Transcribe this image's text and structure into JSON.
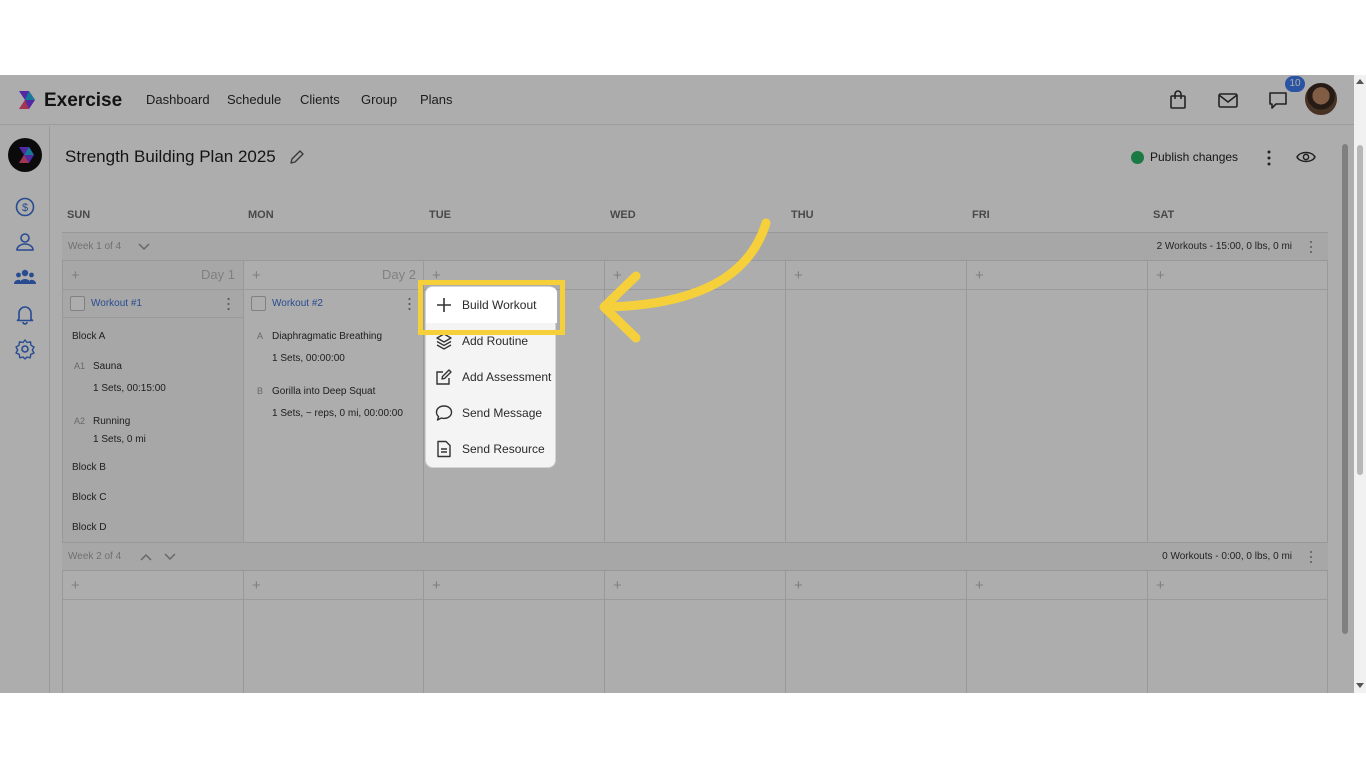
{
  "app": {
    "brand": "Exercise",
    "notification_count": "10"
  },
  "nav": [
    "Dashboard",
    "Schedule",
    "Clients",
    "Group",
    "Plans"
  ],
  "plan": {
    "title": "Strength Building Plan 2025",
    "publish_label": "Publish changes",
    "publish_color": "#28b463"
  },
  "days": [
    "SUN",
    "MON",
    "TUE",
    "WED",
    "THU",
    "FRI",
    "SAT"
  ],
  "weeks": [
    {
      "label": "Week 1 of 4",
      "summary": "2 Workouts - 15:00, 0 lbs, 0 mi"
    },
    {
      "label": "Week 2 of 4",
      "summary": "0 Workouts - 0:00, 0 lbs, 0 mi"
    }
  ],
  "day_labels": {
    "sun": "Day 1",
    "mon": "Day 2"
  },
  "workout1": {
    "title": "Workout #1",
    "block_a": "Block A",
    "a1_tag": "A1",
    "a1_name": "Sauna",
    "a1_detail": "1 Sets, 00:15:00",
    "a2_tag": "A2",
    "a2_name": "Running",
    "a2_detail": "1 Sets, 0 mi",
    "block_b": "Block B",
    "block_c": "Block C",
    "block_d": "Block D"
  },
  "workout2": {
    "title": "Workout #2",
    "a_tag": "A",
    "a_name": "Diaphragmatic Breathing",
    "a_detail": "1 Sets, 00:00:00",
    "b_tag": "B",
    "b_name": "Gorilla into Deep Squat",
    "b_detail": "1 Sets, ~ reps, 0 mi, 00:00:00"
  },
  "menu": {
    "build": "Build Workout",
    "routine": "Add Routine",
    "assessment": "Add Assessment",
    "message": "Send Message",
    "resource": "Send Resource"
  },
  "colors": {
    "highlight": "#f6d03b",
    "accent": "#3b6fd6"
  }
}
